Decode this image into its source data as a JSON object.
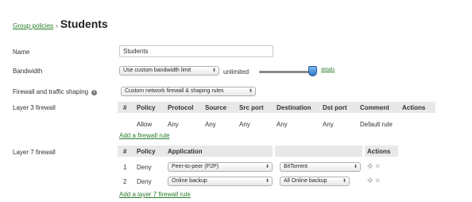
{
  "breadcrumb": {
    "parent": "Group policies",
    "separator": "›",
    "title": "Students"
  },
  "labels": {
    "name": "Name",
    "bandwidth": "Bandwidth",
    "firewall_shaping": "Firewall and traffic shaping",
    "layer3": "Layer 3 firewall",
    "layer7": "Layer 7 firewall"
  },
  "name_field": {
    "value": "Students"
  },
  "bandwidth": {
    "select": "Use custom bandwidth limit",
    "limit_text": "unlimited",
    "details_link": "details",
    "slider_level_percent": 100
  },
  "firewall_select": "Custom network firewall & shaping rules",
  "layer3": {
    "headers": [
      "#",
      "Policy",
      "Protocol",
      "Source",
      "Src port",
      "Destination",
      "Dst port",
      "Comment",
      "Actions"
    ],
    "row": {
      "num": "",
      "policy": "Allow",
      "protocol": "Any",
      "source": "Any",
      "src_port": "Any",
      "destination": "Any",
      "dst_port": "Any",
      "comment": "Default rule"
    },
    "add_link": "Add a firewall rule"
  },
  "layer7": {
    "headers": [
      "#",
      "Policy",
      "Application",
      "",
      "Actions"
    ],
    "rows": [
      {
        "num": "1",
        "policy": "Deny",
        "category": "Peer-to-peer (P2P)",
        "app": "BitTorrent"
      },
      {
        "num": "2",
        "policy": "Deny",
        "category": "Online backup",
        "app": "All Online backup"
      }
    ],
    "add_link": "Add a layer 7 firewall rule"
  },
  "icons": {
    "move": "move-arrows-icon",
    "delete": "delete-x-icon",
    "info": "info-icon",
    "dropdown": "updown-arrows-icon"
  },
  "colors": {
    "link": "#2a7d2a",
    "header_bg": "#e8e8e8",
    "slider_handle": "#2f78c8"
  }
}
